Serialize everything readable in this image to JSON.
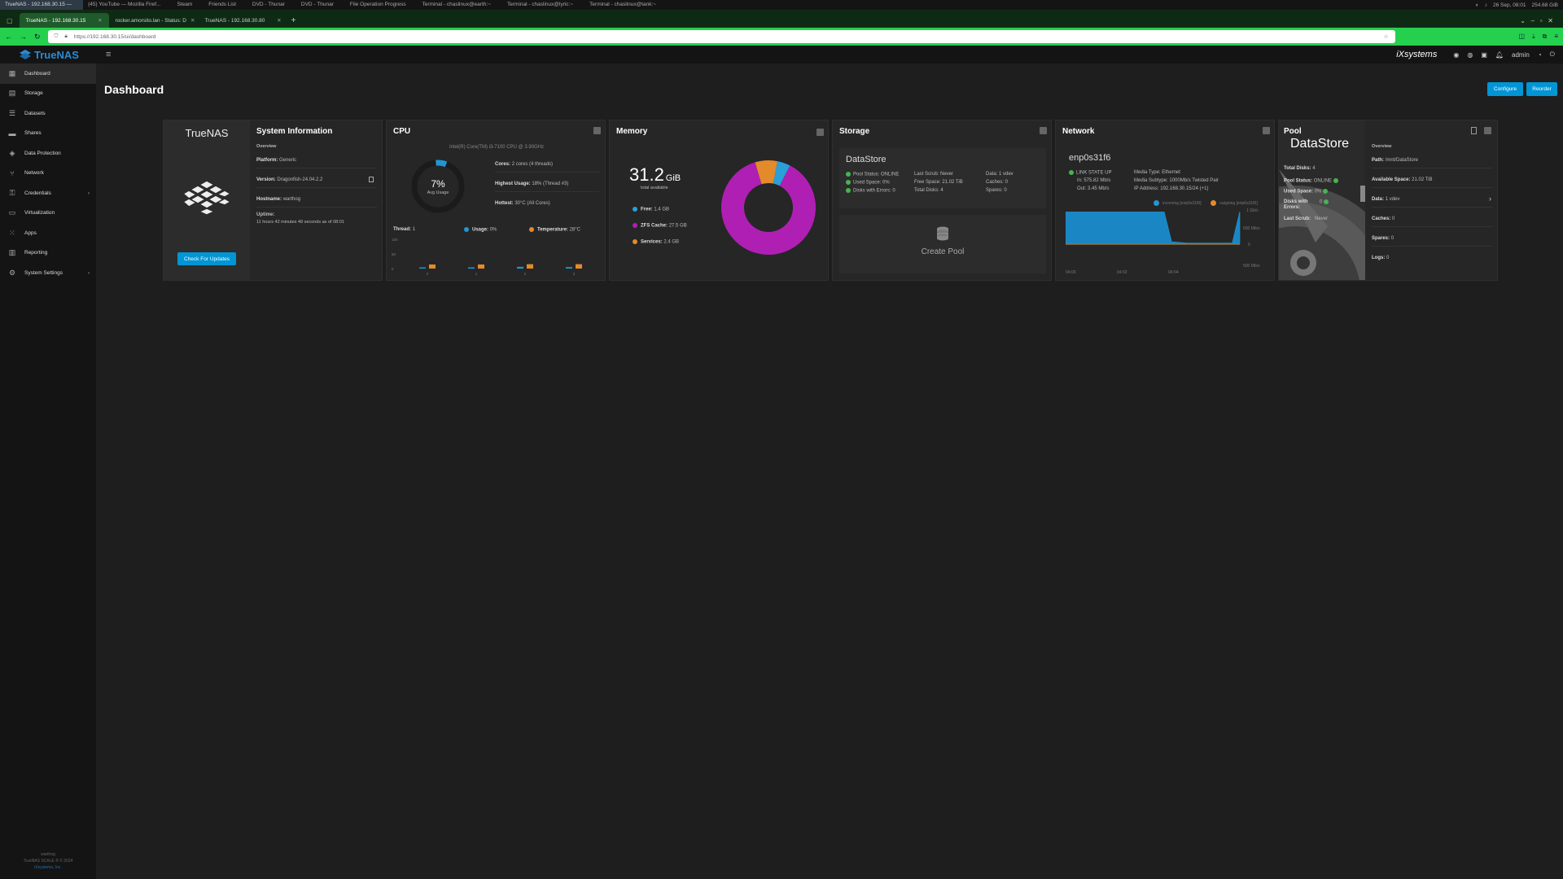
{
  "os_bar": {
    "tasks": [
      "TrueNAS - 192.168.30.15 —",
      "(45) YouTube — Mozilla Firef...",
      "Steam",
      "Friends List",
      "DVD - Thunar",
      "DVD - Thunar",
      "File Operation Progress",
      "Terminal - chaslinux@earth:~",
      "Terminal - chaslinux@lyric:~",
      "Terminal - chaslinux@tank:~"
    ],
    "date": "26 Sep, 08:01",
    "storage": "254.68 GiB"
  },
  "browser": {
    "tabs": [
      {
        "label": "TrueNAS - 192.168.30.15",
        "active": true
      },
      {
        "label": "rocker.amorsito.lan - Status: D",
        "active": false
      },
      {
        "label": "TrueNAS - 192.168.30.80",
        "active": false
      }
    ],
    "new_tab": "+",
    "url": "https://192.168.30.15/ui/dashboard"
  },
  "header": {
    "logo_text": "TrueNAS",
    "brand": "iXsystems",
    "user": "admin"
  },
  "sidebar": {
    "items": [
      {
        "label": "Dashboard",
        "icon": "dashboard-icon",
        "glyph": "▦"
      },
      {
        "label": "Storage",
        "icon": "storage-icon",
        "glyph": "▤"
      },
      {
        "label": "Datasets",
        "icon": "datasets-icon",
        "glyph": "☰"
      },
      {
        "label": "Shares",
        "icon": "shares-icon",
        "glyph": "▬"
      },
      {
        "label": "Data Protection",
        "icon": "shield-icon",
        "glyph": "◈"
      },
      {
        "label": "Network",
        "icon": "network-icon",
        "glyph": "⑂"
      },
      {
        "label": "Credentials",
        "icon": "key-icon",
        "glyph": "⚿"
      },
      {
        "label": "Virtualization",
        "icon": "monitor-icon",
        "glyph": "▭"
      },
      {
        "label": "Apps",
        "icon": "apps-icon",
        "glyph": "⁙"
      },
      {
        "label": "Reporting",
        "icon": "reporting-icon",
        "glyph": "▥"
      },
      {
        "label": "System Settings",
        "icon": "gear-icon",
        "glyph": "⚙"
      }
    ],
    "footer_host": "warthog",
    "footer_version": "TrueNAS SCALE ® © 2024",
    "footer_link": "iXsystems, Inc."
  },
  "page": {
    "title": "Dashboard",
    "configure_label": "Configure",
    "reorder_label": "Reorder"
  },
  "sysinfo": {
    "logo_text": "TrueNAS",
    "title": "System Information",
    "overview": "Overview",
    "platform_label": "Platform:",
    "platform": "Generic",
    "version_label": "Version:",
    "version": "Dragonfish-24.04.2.2",
    "hostname_label": "Hostname:",
    "hostname": "warthog",
    "uptime_label": "Uptime:",
    "uptime": "11 hours 42 minutes 49 seconds as of 08:01",
    "update_button": "Check For Updates"
  },
  "cpu": {
    "title": "CPU",
    "model": "Intel(R) Core(TM) i3-7100 CPU @ 3.90GHz",
    "avg_usage": "7%",
    "avg_usage_fraction": 0.07,
    "avg_label": "Avg Usage",
    "cores_label": "Cores:",
    "cores": "2 cores (4 threads)",
    "highest_label": "Highest Usage:",
    "highest": "18% (Thread #3)",
    "hottest_label": "Hottest:",
    "hottest": "30°C (All Cores)",
    "thread_label": "Thread:",
    "thread": "1",
    "usage_label": "Usage:",
    "usage": "0%",
    "temp_label": "Temperature:",
    "temp": "28°C",
    "y_ticks": [
      "100",
      "50",
      "0"
    ],
    "x_ticks": [
      "0",
      "1",
      "2",
      "3"
    ],
    "usage_color": "#2196d3",
    "temp_color": "#e38a2b"
  },
  "memory": {
    "title": "Memory",
    "total": "31.2",
    "unit": "GiB",
    "total_label": "total available",
    "legend": [
      {
        "label": "Free:",
        "value": "1.4 GB",
        "color": "#2a9fd8"
      },
      {
        "label": "ZFS Cache:",
        "value": "27.5 GB",
        "color": "#b01fb3"
      },
      {
        "label": "Services:",
        "value": "2.4 GB",
        "color": "#e38a2b"
      }
    ]
  },
  "storage": {
    "title": "Storage",
    "pool_name": "DataStore",
    "pool_status": "Pool Status:  ONLINE",
    "used_space": "Used Space:  0%",
    "disks_errors": "Disks with Errors:  0",
    "last_scrub": "Last Scrub:  Never",
    "free_space": "Free Space:  21.02 TiB",
    "total_disks": "Total Disks:  4",
    "data": "Data:  1 vdev",
    "caches": "Caches:  0",
    "spares": "Spares:  0",
    "create_pool": "Create Pool"
  },
  "network": {
    "title": "Network",
    "interface": "enp0s31f6",
    "link_state": "LINK STATE UP",
    "in": "In:  575.82 Mb/s",
    "out": "Out:  3.45 Mb/s",
    "media_type": "Media Type:  Ethernet",
    "media_subtype": "Media Subtype:  1000Mb/s Twisted Pair",
    "ip_address": "IP Address:  192.168.30.15/24 (+1)",
    "legend_in": "incoming [enp0s31f6]",
    "legend_out": "outgoing [enp0s31f6]",
    "y_ticks": [
      "1 Gb/s",
      "500 Mb/s",
      "0",
      "500 Mb/s"
    ],
    "x_ticks": [
      "04:00",
      "04:02",
      "04:04"
    ]
  },
  "pool": {
    "title": "Pool",
    "name": "DataStore",
    "total_disks_label": "Total Disks:",
    "total_disks": "4",
    "status_label": "Pool Status:",
    "status": "ONLINE",
    "used_label": "Used Space:",
    "used": "0%",
    "errors_label": "Disks with Errors:",
    "errors": "0",
    "scrub_label": "Last Scrub:",
    "scrub": "Never",
    "overview": "Overview",
    "path_label": "Path:",
    "path": "/mnt/DataStore",
    "avail_label": "Available Space:",
    "avail": "21.02 TiB",
    "data_label": "Data:",
    "data": "1 vdev",
    "caches_label": "Caches:",
    "caches": "0",
    "spares_label": "Spares:",
    "spares": "0",
    "logs_label": "Logs:",
    "logs": "0"
  },
  "chart_data": [
    {
      "type": "pie",
      "title": "",
      "categories": [
        "Free",
        "ZFS Cache",
        "Services"
      ],
      "values": [
        1.4,
        27.5,
        2.4
      ],
      "unit": "GB"
    },
    {
      "type": "bar",
      "title": "",
      "categories": [
        "0",
        "1",
        "2",
        "3"
      ],
      "series": [
        {
          "name": "Usage",
          "values": [
            3,
            0,
            6,
            5
          ]
        },
        {
          "name": "Temperature",
          "values": [
            28,
            28,
            30,
            30
          ]
        }
      ],
      "ylim": [
        0,
        100
      ]
    },
    {
      "type": "area",
      "title": "",
      "series": [
        {
          "name": "incoming [enp0s31f6]",
          "values": [
            560,
            565,
            570,
            575,
            568,
            572,
            575,
            570,
            576,
            574,
            572,
            575,
            575,
            560,
            40,
            30,
            20,
            20,
            20,
            20,
            20,
            20,
            20,
            560
          ]
        },
        {
          "name": "outgoing [enp0s31f6]",
          "values": [
            3,
            3,
            3,
            3,
            3,
            3,
            3,
            3,
            3,
            3,
            3,
            3,
            3,
            3,
            3,
            3,
            3,
            3,
            3,
            3,
            3,
            3,
            3,
            3
          ]
        }
      ],
      "unit": "Mb/s"
    }
  ]
}
